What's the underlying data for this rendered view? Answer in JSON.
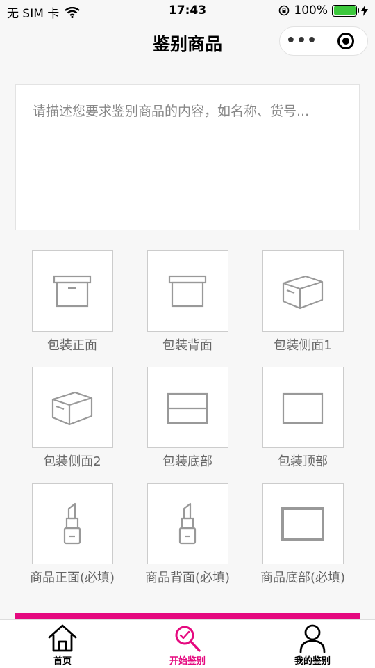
{
  "status_bar": {
    "carrier": "无 SIM 卡",
    "time": "17:43",
    "battery": "100%",
    "battery_color": "#3cc83c"
  },
  "nav": {
    "title": "鉴别商品",
    "more_label": "•••"
  },
  "description": {
    "placeholder": "请描述您要求鉴别商品的内容，如名称、货号...",
    "value": ""
  },
  "photo_slots": [
    {
      "label": "包装正面",
      "icon": "box-front-icon"
    },
    {
      "label": "包装背面",
      "icon": "box-back-icon"
    },
    {
      "label": "包装侧面1",
      "icon": "box-side-icon"
    },
    {
      "label": "包装侧面2",
      "icon": "box-side-icon"
    },
    {
      "label": "包装底部",
      "icon": "box-bottom-icon"
    },
    {
      "label": "包装顶部",
      "icon": "box-top-icon"
    },
    {
      "label": "商品正面(必填)",
      "icon": "lipstick-icon"
    },
    {
      "label": "商品背面(必填)",
      "icon": "lipstick-icon"
    },
    {
      "label": "商品底部(必填)",
      "icon": "product-bottom-icon"
    }
  ],
  "tabs": [
    {
      "label": "首页",
      "icon": "home-icon"
    },
    {
      "label": "开始鉴别",
      "icon": "identify-icon"
    },
    {
      "label": "我的鉴别",
      "icon": "profile-icon"
    }
  ],
  "accent_color": "#e5097f"
}
